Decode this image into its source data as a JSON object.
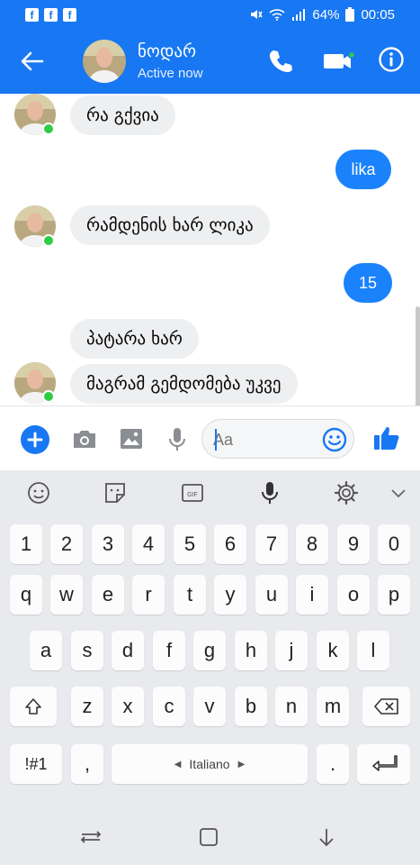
{
  "status_bar": {
    "battery": "64%",
    "time": "00:05"
  },
  "header": {
    "contact_name": "ნოდარ",
    "contact_status": "Active now"
  },
  "messages": [
    {
      "direction": "in",
      "text": "რა გქვია",
      "avatar": true
    },
    {
      "direction": "out",
      "text": "lika"
    },
    {
      "direction": "in",
      "text": "რამდენის ხარ ლიკა",
      "avatar": true
    },
    {
      "direction": "out",
      "text": "15"
    },
    {
      "direction": "in",
      "text": "პატარა ხარ",
      "avatar": false
    },
    {
      "direction": "in",
      "text": "მაგრამ გემდომება უკვე",
      "avatar": true
    }
  ],
  "composer": {
    "placeholder": "Aa"
  },
  "keyboard": {
    "number_row": [
      "1",
      "2",
      "3",
      "4",
      "5",
      "6",
      "7",
      "8",
      "9",
      "0"
    ],
    "row1": [
      "q",
      "w",
      "e",
      "r",
      "t",
      "y",
      "u",
      "i",
      "o",
      "p"
    ],
    "row2": [
      "a",
      "s",
      "d",
      "f",
      "g",
      "h",
      "j",
      "k",
      "l"
    ],
    "row3": [
      "z",
      "x",
      "c",
      "v",
      "b",
      "n",
      "m"
    ],
    "symbols_label": "!#1",
    "comma": ",",
    "space_label": "Italiano",
    "period": "."
  },
  "colors": {
    "brand": "#1877f2",
    "outgoing_bubble": "#1a82fb",
    "incoming_bubble": "#eeeff1",
    "online": "#31cc46"
  }
}
